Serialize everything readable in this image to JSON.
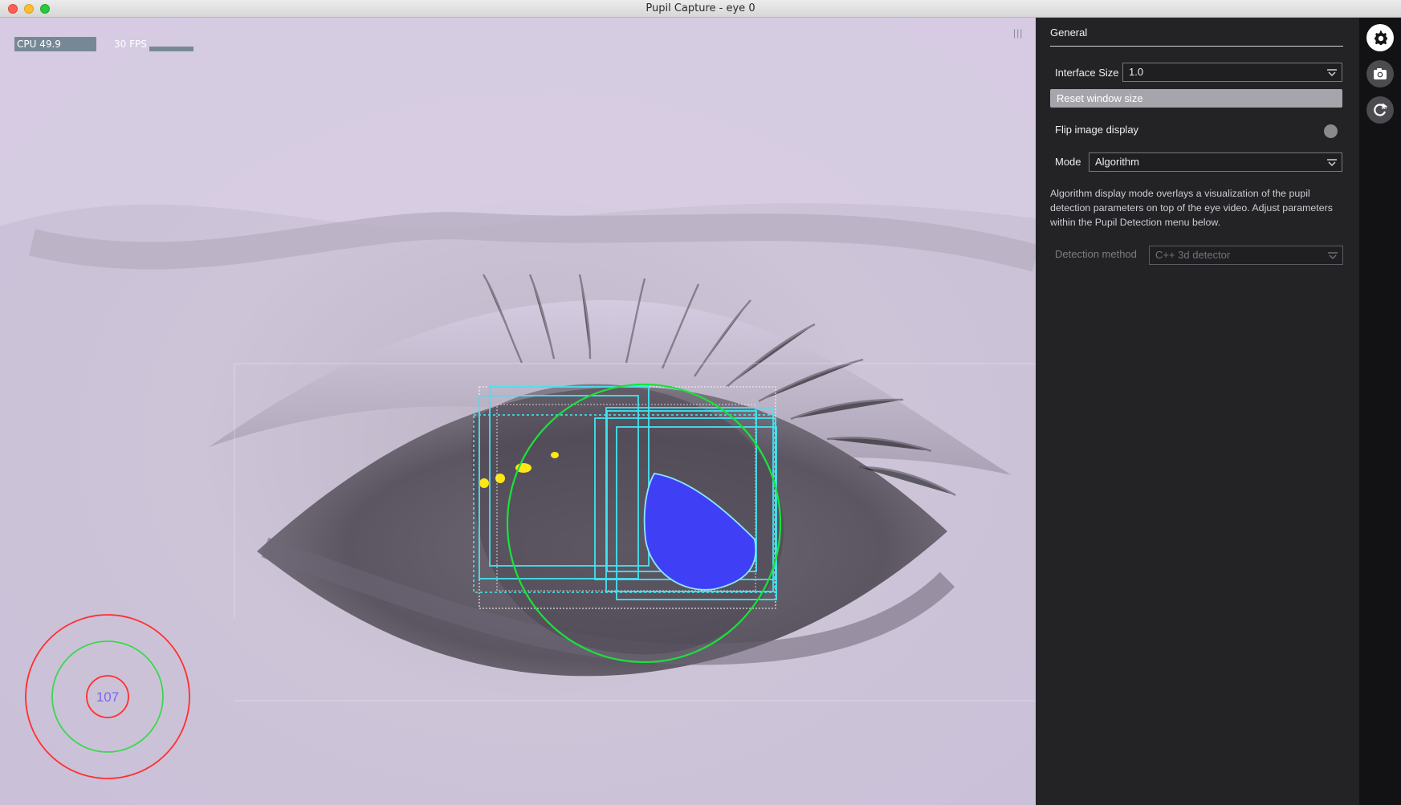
{
  "window": {
    "title": "Pupil Capture - eye 0"
  },
  "video": {
    "cpu_label": "CPU 49.9",
    "fps_label": "30 FPS",
    "confidence_value": "107",
    "menu_grip_icon": "menu-grip-icon",
    "colors": {
      "pupil_fill": "#3f3ff5",
      "pupil_outline": "#8ce7ff",
      "search_boxes": "#41e4f0",
      "eye_circle": "#19e23a",
      "target_red": "#ff2f2f",
      "target_green": "#39d84c",
      "glint_yellow": "#ffe616"
    }
  },
  "menu": {
    "section_title": "General",
    "interface_size_label": "Interface Size",
    "interface_size_value": "1.0",
    "reset_button_label": "Reset window size",
    "flip_label": "Flip image display",
    "mode_label": "Mode",
    "mode_value": "Algorithm",
    "help_text": "Algorithm display mode overlays a visualization of the pupil detection parameters on top of the eye video. Adjust parameters within the Pupil Detection menu below.",
    "detection_method_label": "Detection method",
    "detection_method_value": "C++ 3d detector"
  },
  "icons": [
    {
      "name": "settings-gear-icon",
      "active": true
    },
    {
      "name": "camera-icon",
      "active": false
    },
    {
      "name": "reset-3d-model-icon",
      "active": false
    }
  ]
}
